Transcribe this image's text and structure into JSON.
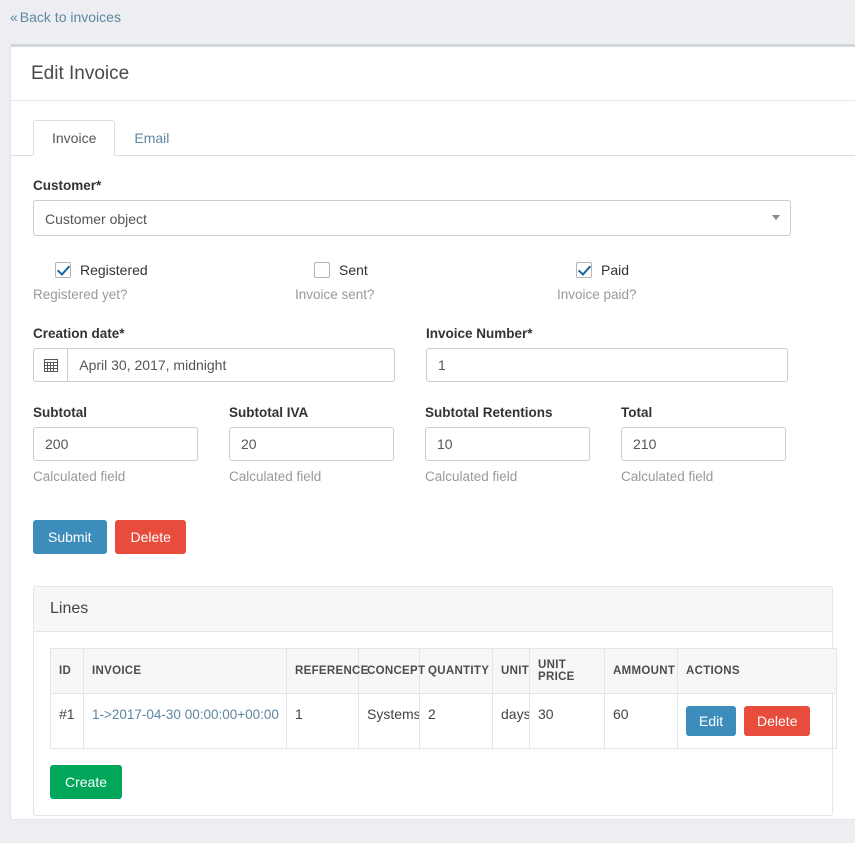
{
  "back_link": {
    "label": "Back to invoices",
    "chevron": "«",
    "icon": "double-chevron-left-icon"
  },
  "card": {
    "title": "Edit Invoice"
  },
  "tabs": [
    {
      "label": "Invoice",
      "active": true
    },
    {
      "label": "Email",
      "active": false
    }
  ],
  "form": {
    "customer": {
      "label": "Customer*",
      "value": "Customer object",
      "arrow_icon": "chevron-down-icon"
    },
    "checkboxes": [
      {
        "label": "Registered",
        "checked": true,
        "help": "Registered yet?"
      },
      {
        "label": "Sent",
        "checked": false,
        "help": "Invoice sent?"
      },
      {
        "label": "Paid",
        "checked": true,
        "help": "Invoice paid?"
      }
    ],
    "creation_date": {
      "label": "Creation date*",
      "value": "April 30, 2017, midnight",
      "icon": "calendar-icon"
    },
    "invoice_number": {
      "label": "Invoice Number*",
      "value": "1"
    },
    "amounts": [
      {
        "label": "Subtotal",
        "value": "200",
        "help": "Calculated field"
      },
      {
        "label": "Subtotal IVA",
        "value": "20",
        "help": "Calculated field"
      },
      {
        "label": "Subtotal Retentions",
        "value": "10",
        "help": "Calculated field"
      },
      {
        "label": "Total",
        "value": "210",
        "help": "Calculated field"
      }
    ],
    "submit_label": "Submit",
    "delete_label": "Delete"
  },
  "lines": {
    "title": "Lines",
    "columns": [
      "ID",
      "INVOICE",
      "REFERENCE",
      "CONCEPT",
      "QUANTITY",
      "UNIT",
      "UNIT PRICE",
      "AMMOUNT",
      "ACTIONS"
    ],
    "rows": [
      {
        "id": "#1",
        "invoice": "1->2017-04-30 00:00:00+00:00",
        "reference": "1",
        "concept": "Systems",
        "quantity": "2",
        "unit": "days",
        "unit_price": "30",
        "ammount": "60",
        "edit_label": "Edit",
        "delete_label": "Delete"
      }
    ],
    "create_label": "Create"
  },
  "colors": {
    "page_bg": "#eceef1",
    "link": "#5d87a1",
    "primary": "#3c8dbc",
    "danger": "#e74c3c",
    "success": "#00a65a",
    "checkmark": "#1464a0"
  }
}
